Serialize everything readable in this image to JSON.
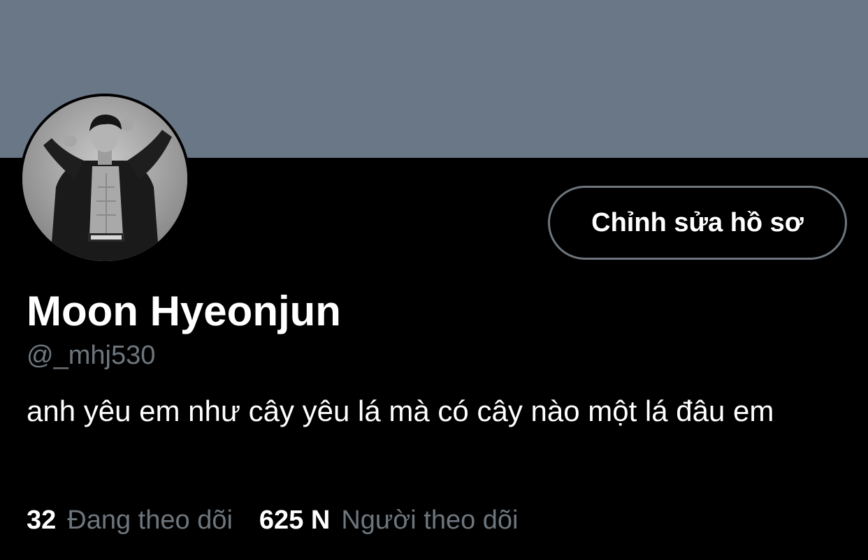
{
  "profile": {
    "banner_color": "#697787",
    "avatar_alt": "avatar",
    "display_name": "Moon Hyeonjun",
    "handle": "@_mhj530",
    "bio": "anh yêu em như cây yêu lá mà có cây nào một lá đâu em"
  },
  "actions": {
    "edit_profile_label": "Chỉnh sửa hồ sơ"
  },
  "stats": {
    "following_count": "32",
    "following_label": "Đang theo dõi",
    "followers_count": "625 N",
    "followers_label": "Người theo dõi"
  },
  "colors": {
    "background": "#000000",
    "text_primary": "#ffffff",
    "text_secondary": "#6e767d",
    "border": "#6e767d"
  }
}
